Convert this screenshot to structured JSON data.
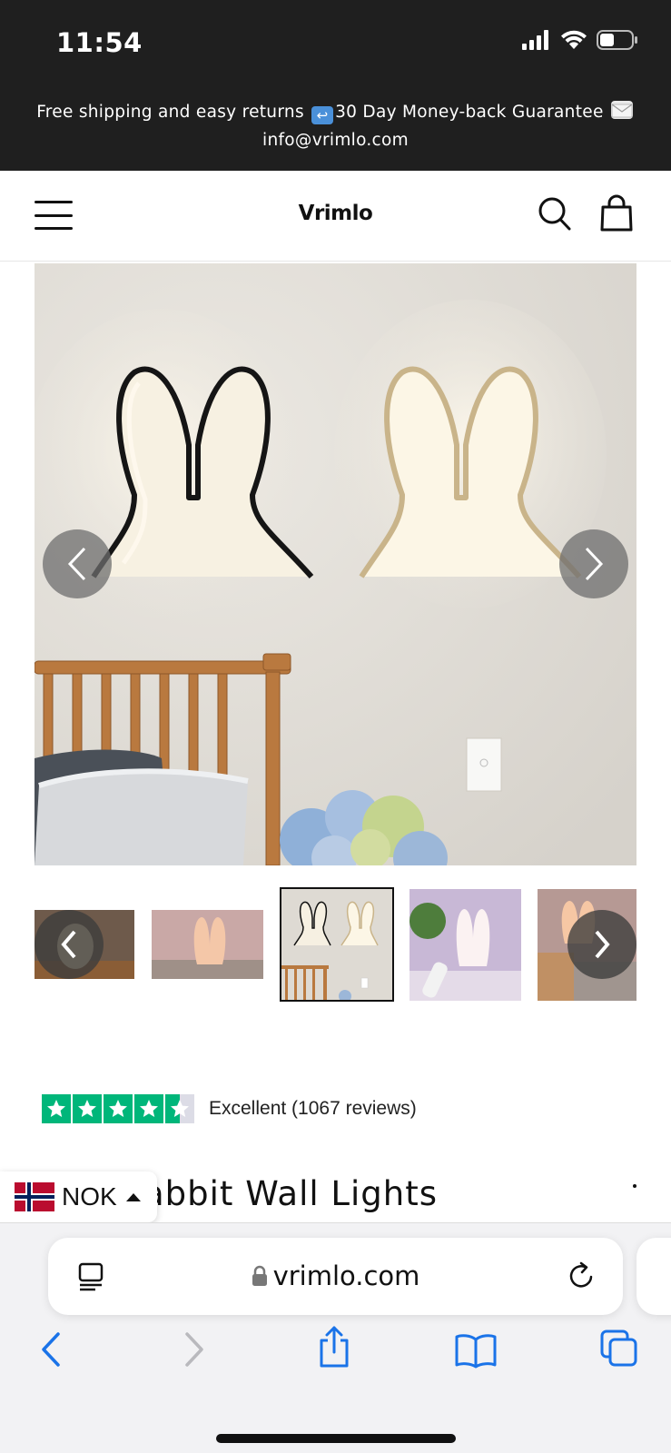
{
  "status_bar": {
    "time": "11:54",
    "icons": [
      "signal-icon",
      "wifi-icon",
      "battery-icon"
    ]
  },
  "announcement": {
    "line1_part1": "Free shipping and easy returns",
    "line1_part2": "30 Day Money-back Guarantee",
    "line2": "info@vrimlo.com"
  },
  "header": {
    "logo": "Vrimlo"
  },
  "gallery": {
    "main_image_alt": "Rabbit wall lights, black and gold, above a wooden bed",
    "thumbnail_count": 5,
    "active_thumbnail": 3
  },
  "reviews": {
    "text": "Excellent (1067 reviews)",
    "rating": 4.5,
    "star_color": "#00b67a"
  },
  "product": {
    "title_visible": "abbit Wall Lights"
  },
  "currency": {
    "code": "NOK"
  },
  "browser": {
    "url": "vrimlo.com",
    "accent": "#1a73e8"
  }
}
